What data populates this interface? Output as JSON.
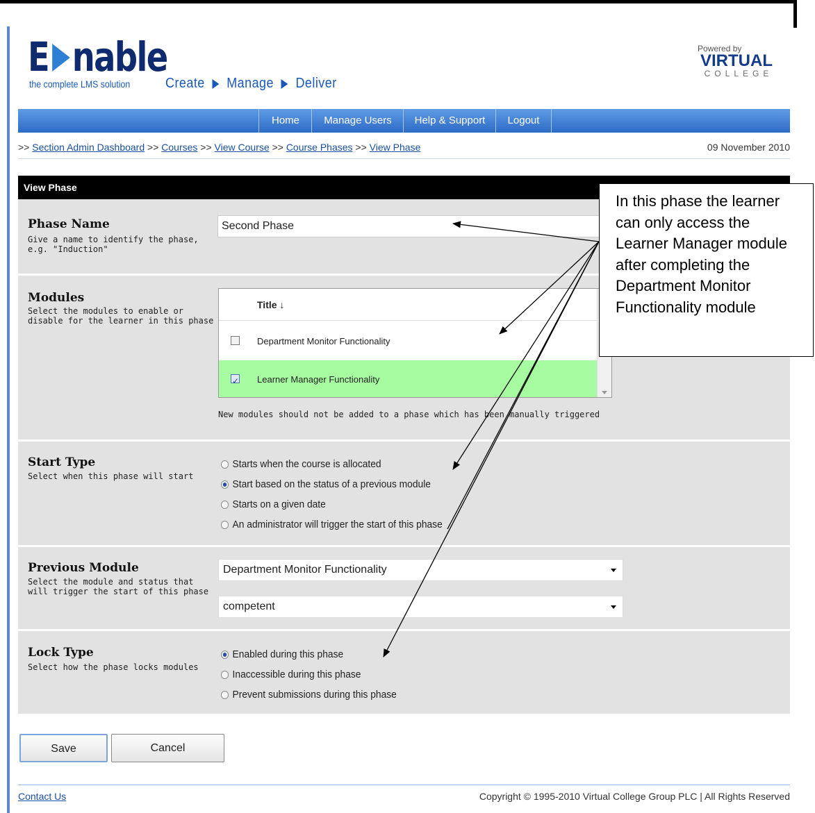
{
  "brand": {
    "logo_prefix": "E",
    "logo_suffix": "nable",
    "subtitle": "the complete LMS solution",
    "tagline": [
      "Create",
      "Manage",
      "Deliver"
    ],
    "powered_by": "Powered by",
    "partner_name": "VIRTUAL",
    "partner_sub": "COLLEGE"
  },
  "nav": {
    "items": [
      "Home",
      "Manage Users",
      "Help & Support",
      "Logout"
    ]
  },
  "breadcrumb": {
    "prefix": ">>",
    "items": [
      "Section Admin Dashboard",
      "Courses",
      "View Course",
      "Course Phases",
      "View Phase"
    ],
    "separator": ">>"
  },
  "date": "09 November 2010",
  "section_title": "View Phase",
  "phase_name": {
    "title": "Phase Name",
    "description": "Give a name to identify the phase, e.g. \"Induction\"",
    "value": "Second Phase"
  },
  "modules": {
    "title": "Modules",
    "description": "Select the modules to enable or disable for the learner in this phase",
    "column_header": "Title ↓",
    "rows": [
      {
        "label": "Department Monitor Functionality",
        "checked": false
      },
      {
        "label": "Learner Manager Functionality",
        "checked": true
      }
    ],
    "note": "New modules should not be added to a phase which has been manually triggered"
  },
  "start_type": {
    "title": "Start Type",
    "description": "Select when this phase will start",
    "options": [
      "Starts when the course is allocated",
      "Start based on the status of a previous module",
      "Starts on a given date",
      "An administrator will trigger the start of this phase"
    ],
    "selected_index": 1
  },
  "previous_module": {
    "title": "Previous Module",
    "description": "Select the module and status that will trigger the start of this phase",
    "module_value": "Department Monitor Functionality",
    "status_value": "competent"
  },
  "lock_type": {
    "title": "Lock Type",
    "description": "Select how the phase locks modules",
    "options": [
      "Enabled during this phase",
      "Inaccessible during this phase",
      "Prevent submissions during this phase"
    ],
    "selected_index": 0
  },
  "buttons": {
    "save": "Save",
    "cancel": "Cancel"
  },
  "footer": {
    "contact": "Contact Us",
    "copyright": "Copyright © 1995-2010 Virtual College Group PLC | All Rights Reserved"
  },
  "callout": "In this phase the learner can only access the Learner Manager module after completing the Department Monitor Functionality module",
  "colors": {
    "nav_blue": "#2d6bc6",
    "selected_row": "#a7fba0",
    "section_bar": "#000000"
  }
}
